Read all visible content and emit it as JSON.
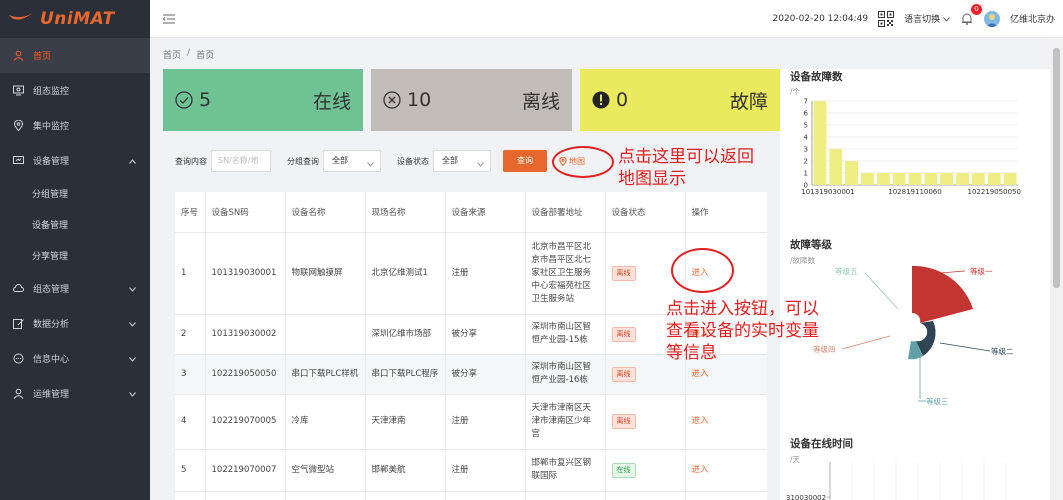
{
  "app": {
    "logo_text": "UniMAT"
  },
  "sidebar": {
    "items": [
      {
        "label": "首页",
        "icon": "user-icon",
        "active": true
      },
      {
        "label": "组态监控",
        "icon": "monitor-icon"
      },
      {
        "label": "集中监控",
        "icon": "location-icon"
      },
      {
        "label": "设备管理",
        "icon": "device-icon",
        "expanded": true
      },
      {
        "label": "组态管理",
        "icon": "cloud-icon"
      },
      {
        "label": "数据分析",
        "icon": "chart-edit-icon"
      },
      {
        "label": "信息中心",
        "icon": "message-icon"
      },
      {
        "label": "运维管理",
        "icon": "user-ops-icon"
      }
    ],
    "device_sub": [
      "分组管理",
      "设备管理",
      "分享管理"
    ]
  },
  "header": {
    "datetime": "2020-02-20 12:04:49",
    "language": "语言切换",
    "notify_count": "0",
    "username": "亿维北京办"
  },
  "breadcrumb": [
    "首页",
    "/",
    "首页"
  ],
  "cards": {
    "online": {
      "count": "5",
      "label": "在线"
    },
    "offline": {
      "count": "10",
      "label": "离线"
    },
    "fault": {
      "count": "0",
      "label": "故障"
    }
  },
  "filters": {
    "content_label": "查询内容",
    "content_placeholder": "SN/名称/地",
    "group_label": "分组查询",
    "group_value": "全部",
    "status_label": "设备状态",
    "status_value": "全部",
    "query_button": "查询",
    "map_link": "地图"
  },
  "table": {
    "headers": [
      "序号",
      "设备SN码",
      "设备名称",
      "现场名称",
      "设备来源",
      "设备部署地址",
      "设备状态",
      "操作"
    ],
    "rows": [
      {
        "no": "1",
        "sn": "101319030001",
        "name": "物联网触摸屏",
        "site": "北京亿维测试1",
        "source": "注册",
        "address": "北京市昌平区北京市昌平区北七家社区卫生服务中心宏福苑社区卫生服务站",
        "status": "离线",
        "status_type": "offline",
        "op": "进入"
      },
      {
        "no": "2",
        "sn": "101319030002",
        "name": "",
        "site": "深圳亿维市场部",
        "source": "被分享",
        "address": "深圳市南山区智恒产业园-15栋",
        "status": "离线",
        "status_type": "offline",
        "op": "进入"
      },
      {
        "no": "3",
        "sn": "102219050050",
        "name": "串口下载PLC样机",
        "site": "串口下载PLC程序",
        "source": "被分享",
        "address": "深圳市南山区智恒产业园-16栋",
        "status": "离线",
        "status_type": "offline",
        "op": "进入"
      },
      {
        "no": "4",
        "sn": "102219070005",
        "name": "冷库",
        "site": "天津津南",
        "source": "注册",
        "address": "天津市津南区天津市津南区少年宫",
        "status": "离线",
        "status_type": "offline",
        "op": "进入"
      },
      {
        "no": "5",
        "sn": "102219070007",
        "name": "空气微型站",
        "site": "邯郸美航",
        "source": "注册",
        "address": "邯郸市复兴区钢联国际",
        "status": "在线",
        "status_type": "online",
        "op": "进入"
      }
    ]
  },
  "fault_count_chart": {
    "title": "设备故障数",
    "unit": "/个",
    "y_ticks": [
      "0",
      "1",
      "2",
      "3",
      "4",
      "5",
      "6",
      "7"
    ],
    "x_labels": [
      "101319030001",
      "102819110060",
      "102219050050"
    ],
    "values": [
      7,
      3,
      2,
      1,
      1,
      1,
      1,
      1,
      1,
      1,
      1,
      1,
      1
    ],
    "bar_color": "#eeee84"
  },
  "fault_level_chart": {
    "title": "故障等级",
    "unit": "/故障数",
    "labels": [
      "等级一",
      "等级二",
      "等级三",
      "等级四",
      "等级五"
    ],
    "colors": {
      "level1": "#c23531",
      "level2": "#2f4554",
      "level3": "#61a0a8",
      "level4": "#d48265",
      "level5": "#91c7ae"
    }
  },
  "online_time_chart": {
    "title": "设备在线时间",
    "unit": "/天",
    "first_label": "310030002"
  },
  "annotations": {
    "map_hint": [
      "点击这里可以返回",
      "地图显示"
    ],
    "enter_hint": [
      "点击进入按钮，可以",
      "查看设备的实时变量",
      "等信息"
    ]
  }
}
